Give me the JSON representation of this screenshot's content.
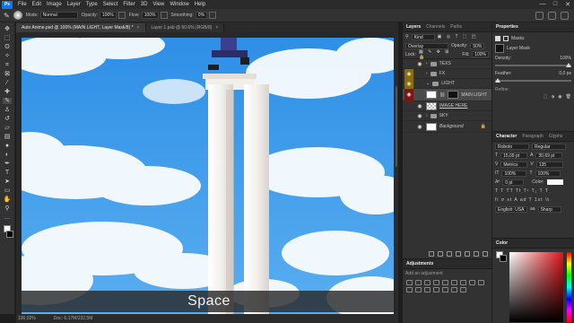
{
  "app": {
    "logo": "Ps"
  },
  "menu": [
    "File",
    "Edit",
    "Image",
    "Layer",
    "Type",
    "Select",
    "Filter",
    "3D",
    "View",
    "Window",
    "Help"
  ],
  "window_controls": [
    "—",
    "□",
    "✕"
  ],
  "options": {
    "mode_label": "Mode:",
    "mode_value": "Normal",
    "opacity_label": "Opacity:",
    "opacity_value": "100%",
    "flow_label": "Flow:",
    "flow_value": "100%",
    "smoothing_label": "Smoothing:",
    "smoothing_value": "0%"
  },
  "tabs": [
    {
      "label": "Auto Anime.psd @ 100% (MAIN LIGHT, Layer Mask/8) *",
      "close": "×"
    },
    {
      "label": "Layer 1.psb @ 60.6% (RGB/8)",
      "close": "×"
    }
  ],
  "status": {
    "zoom": "100,02%",
    "doc": "Doc: 6,17M/232,5M"
  },
  "caption": "Space",
  "layers_panel": {
    "tabs": [
      "Layers",
      "Channels",
      "Paths"
    ],
    "kind": "Kind",
    "blend_mode": "Overlay",
    "opacity_label": "Opacity:",
    "opacity_value": "50%",
    "lock_label": "Lock:",
    "fill_label": "Fill:",
    "fill_value": "100%",
    "layers": [
      {
        "name": "TEXS",
        "type": "folder",
        "tag": ""
      },
      {
        "name": "FX",
        "type": "folder",
        "tag": "yellow"
      },
      {
        "name": "LIGHT",
        "type": "folder",
        "tag": "yellow"
      },
      {
        "name": "MAIN LIGHT",
        "type": "layer-mask",
        "tag": "red",
        "selected": true
      },
      {
        "name": "IMAGE HERE",
        "type": "smart",
        "tag": ""
      },
      {
        "name": "SKY",
        "type": "folder",
        "tag": ""
      },
      {
        "name": "Background",
        "type": "background",
        "tag": ""
      }
    ]
  },
  "adjustments": {
    "title": "Adjustments",
    "hint": "Add an adjustment"
  },
  "properties": {
    "tab": "Properties",
    "masks_label": "Masks",
    "layer_mask": "Layer Mask",
    "density_label": "Density:",
    "density_value": "100%",
    "feather_label": "Feather:",
    "feather_value": "0,0 px",
    "refine_label": "Refine:"
  },
  "character": {
    "tabs": [
      "Character",
      "Paragraph",
      "Glyphs"
    ],
    "font": "Roboto",
    "style": "Regular",
    "size": "15,09 pt",
    "leading": "30,69 pt",
    "kerning": "Metrics",
    "tracking": "135",
    "scale_v": "100%",
    "scale_h": "100%",
    "baseline": "0 pt",
    "color_label": "Color:",
    "language": "English: USA",
    "antialias": "Sharp"
  },
  "color_panel": {
    "title": "Color"
  },
  "colors": {
    "accent": "#1473e6",
    "sky": "#3a9be8",
    "yellow_tag": "#b38e00",
    "red_tag": "#a51b1b"
  }
}
